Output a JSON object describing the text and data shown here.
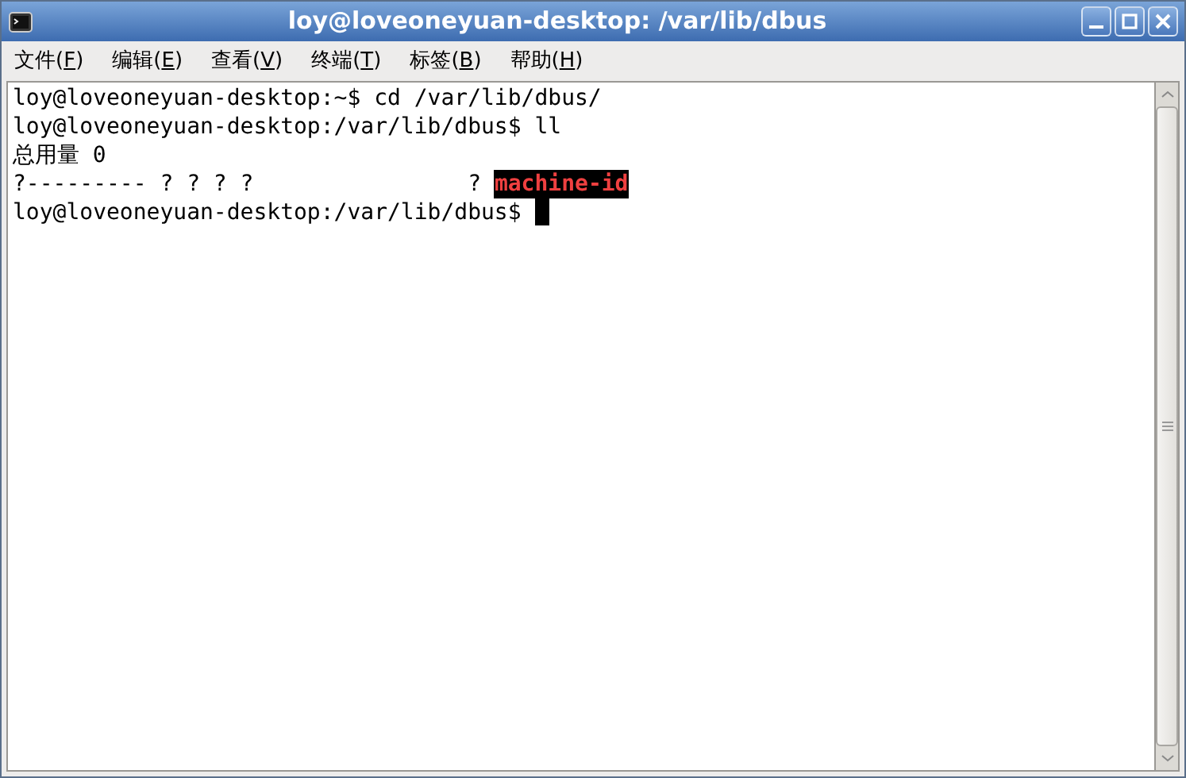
{
  "window": {
    "title": "loy@loveoneyuan-desktop: /var/lib/dbus"
  },
  "menu": [
    {
      "before": "文件(",
      "key": "F",
      "after": ")"
    },
    {
      "before": "编辑(",
      "key": "E",
      "after": ")"
    },
    {
      "before": "查看(",
      "key": "V",
      "after": ")"
    },
    {
      "before": "终端(",
      "key": "T",
      "after": ")"
    },
    {
      "before": "标签(",
      "key": "B",
      "after": ")"
    },
    {
      "before": "帮助(",
      "key": "H",
      "after": ")"
    }
  ],
  "terminal": {
    "lines": [
      {
        "cursor": false,
        "segments": [
          {
            "text": "loy@loveoneyuan-desktop:~$ cd /var/lib/dbus/",
            "highlight": false
          }
        ]
      },
      {
        "cursor": false,
        "segments": [
          {
            "text": "loy@loveoneyuan-desktop:/var/lib/dbus$ ll",
            "highlight": false
          }
        ]
      },
      {
        "cursor": false,
        "segments": [
          {
            "text": "总用量 0",
            "highlight": false
          }
        ]
      },
      {
        "cursor": false,
        "segments": [
          {
            "text": "?--------- ? ? ? ?                ? ",
            "highlight": false
          },
          {
            "text": "machine-id",
            "highlight": true
          }
        ]
      },
      {
        "cursor": true,
        "segments": [
          {
            "text": "loy@loveoneyuan-desktop:/var/lib/dbus$ ",
            "highlight": false
          }
        ]
      }
    ]
  }
}
